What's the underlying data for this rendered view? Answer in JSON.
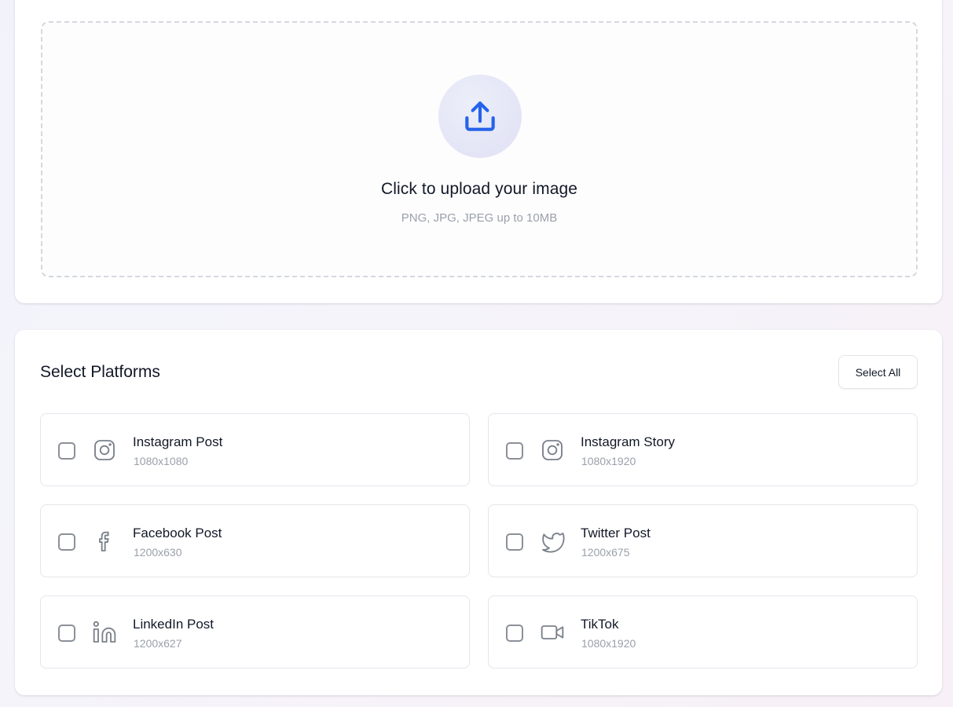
{
  "upload": {
    "icon": "upload-icon",
    "title": "Click to upload your image",
    "hint": "PNG, JPG, JPEG up to 10MB",
    "accent_color": "#2563eb"
  },
  "platforms": {
    "title": "Select Platforms",
    "select_all_label": "Select All",
    "items": [
      {
        "name": "Instagram Post",
        "size": "1080x1080",
        "icon": "instagram-icon",
        "checked": false
      },
      {
        "name": "Instagram Story",
        "size": "1080x1920",
        "icon": "instagram-icon",
        "checked": false
      },
      {
        "name": "Facebook Post",
        "size": "1200x630",
        "icon": "facebook-icon",
        "checked": false
      },
      {
        "name": "Twitter Post",
        "size": "1200x675",
        "icon": "twitter-icon",
        "checked": false
      },
      {
        "name": "LinkedIn Post",
        "size": "1200x627",
        "icon": "linkedin-icon",
        "checked": false
      },
      {
        "name": "TikTok",
        "size": "1080x1920",
        "icon": "video-icon",
        "checked": false
      }
    ]
  }
}
